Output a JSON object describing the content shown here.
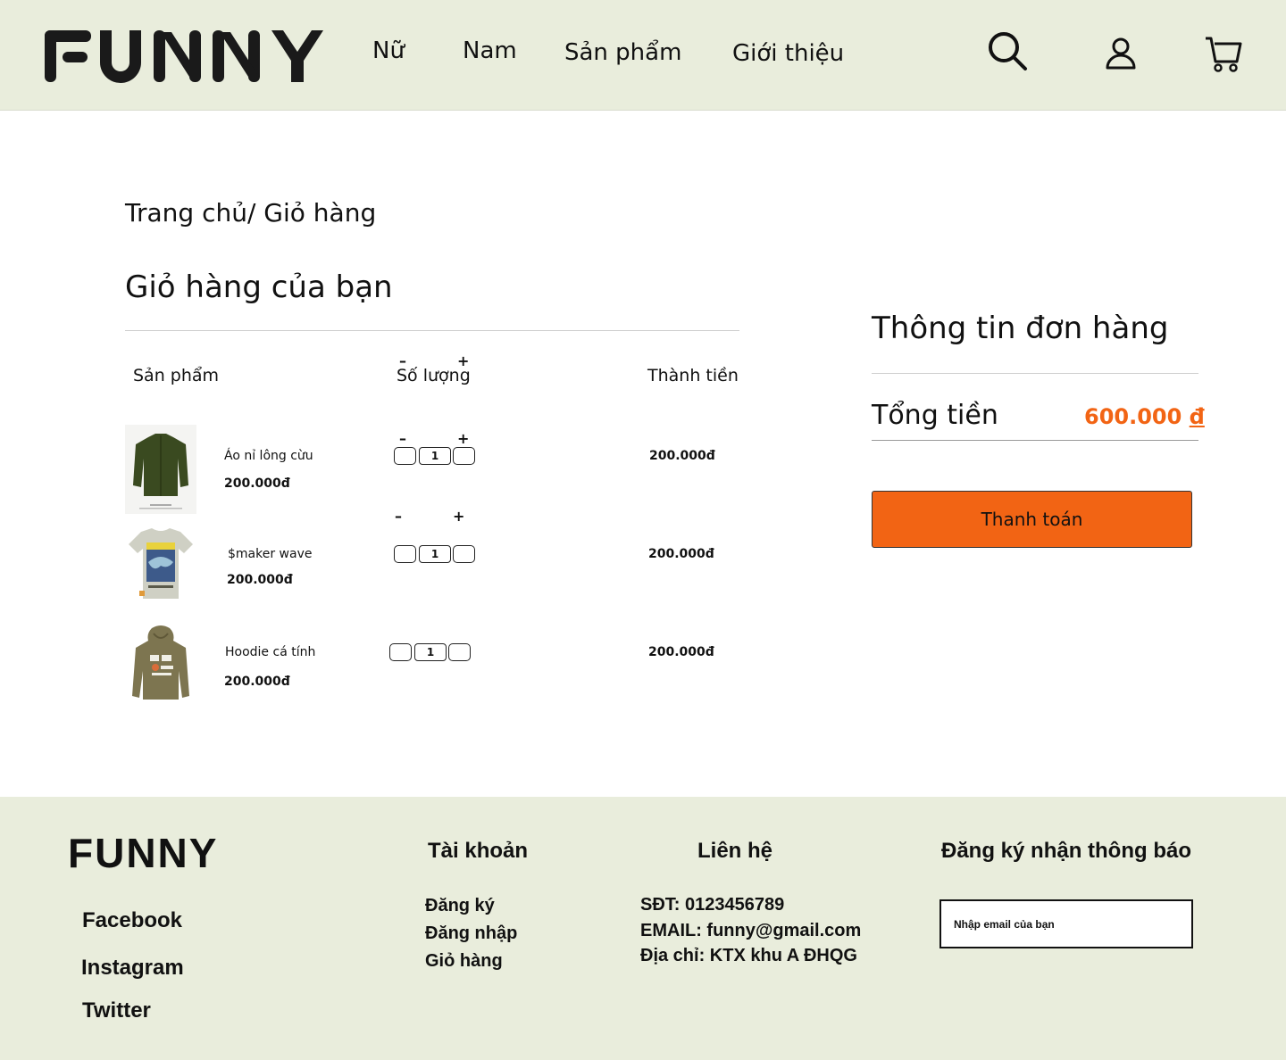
{
  "header": {
    "logo_text": "FUNNY",
    "nav": [
      "Nữ",
      "Nam",
      "Sản phẩm",
      "Giới thiệu"
    ],
    "icons": [
      "search-icon",
      "user-icon",
      "cart-icon"
    ]
  },
  "breadcrumb": "Trang chủ/ Giỏ hàng",
  "cart": {
    "title": "Giỏ hàng của bạn",
    "columns": {
      "product": "Sản phẩm",
      "quantity": "Số lượng",
      "total": "Thành tiền"
    },
    "minus_symbol": "–",
    "plus_symbol": "+",
    "items": [
      {
        "name": "Áo  nỉ lông cừu",
        "price": "200.000đ",
        "quantity": "1",
        "total": "200.000đ",
        "image": "green-fleece-jacket"
      },
      {
        "name": "$maker wave",
        "price": "200.000đ",
        "quantity": "1",
        "total": "200.000đ",
        "image": "graphic-tshirt"
      },
      {
        "name": "Hoodie cá tính",
        "price": "200.000đ",
        "quantity": "1",
        "total": "200.000đ",
        "image": "olive-hoodie"
      }
    ]
  },
  "summary": {
    "title": "Thông tin đơn hàng",
    "total_label": "Tổng tiền",
    "total_amount": "600.000",
    "currency": "đ",
    "checkout_label": "Thanh toán",
    "accent_color": "#f26414"
  },
  "footer": {
    "logo": "FUNNY",
    "social": [
      "Facebook",
      "Instagram",
      "Twitter"
    ],
    "account": {
      "heading": "Tài khoản",
      "links": [
        "Đăng ký",
        "Đăng nhập",
        "Giỏ hàng"
      ]
    },
    "contact": {
      "heading": "Liên hệ",
      "phone": "SĐT: 0123456789",
      "email": "EMAIL: funny@gmail.com",
      "address": "Địa chỉ: KTX khu A ĐHQG"
    },
    "newsletter": {
      "heading": "Đăng ký nhận thông báo",
      "placeholder": "Nhập email của bạn"
    }
  },
  "colors": {
    "header_bg": "#e9eddc",
    "accent": "#f26414"
  }
}
